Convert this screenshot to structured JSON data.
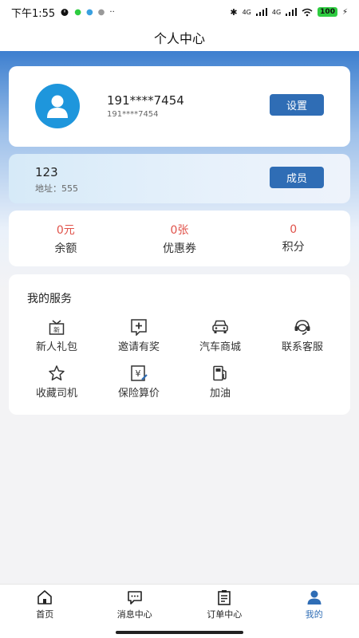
{
  "status_bar": {
    "time": "下午1:55",
    "network_1": "4G",
    "network_2": "4G",
    "battery": "100"
  },
  "header": {
    "title": "个人中心"
  },
  "profile": {
    "phone_main": "191****7454",
    "phone_sub": "191****7454",
    "settings_label": "设置"
  },
  "member": {
    "name": "123",
    "address": "地址：555",
    "member_label": "成员"
  },
  "stats": [
    {
      "value": "0元",
      "label": "余额"
    },
    {
      "value": "0张",
      "label": "优惠券"
    },
    {
      "value": "0",
      "label": "积分"
    }
  ],
  "services": {
    "title": "我的服务",
    "items": [
      {
        "label": "新人礼包",
        "icon": "gift-icon"
      },
      {
        "label": "邀请有奖",
        "icon": "invite-icon"
      },
      {
        "label": "汽车商城",
        "icon": "car-icon"
      },
      {
        "label": "联系客服",
        "icon": "headset-icon"
      },
      {
        "label": "收藏司机",
        "icon": "star-icon"
      },
      {
        "label": "保险算价",
        "icon": "insurance-icon"
      },
      {
        "label": "加油",
        "icon": "fuel-icon"
      }
    ]
  },
  "tabbar": {
    "items": [
      {
        "label": "首页",
        "icon": "home-icon"
      },
      {
        "label": "消息中心",
        "icon": "message-icon"
      },
      {
        "label": "订单中心",
        "icon": "order-icon"
      },
      {
        "label": "我的",
        "icon": "user-icon"
      }
    ],
    "active_color": "#2f6db5"
  },
  "colors": {
    "accent": "#2f6db5",
    "avatar": "#1e96dc",
    "stat_value": "#e0524a"
  }
}
